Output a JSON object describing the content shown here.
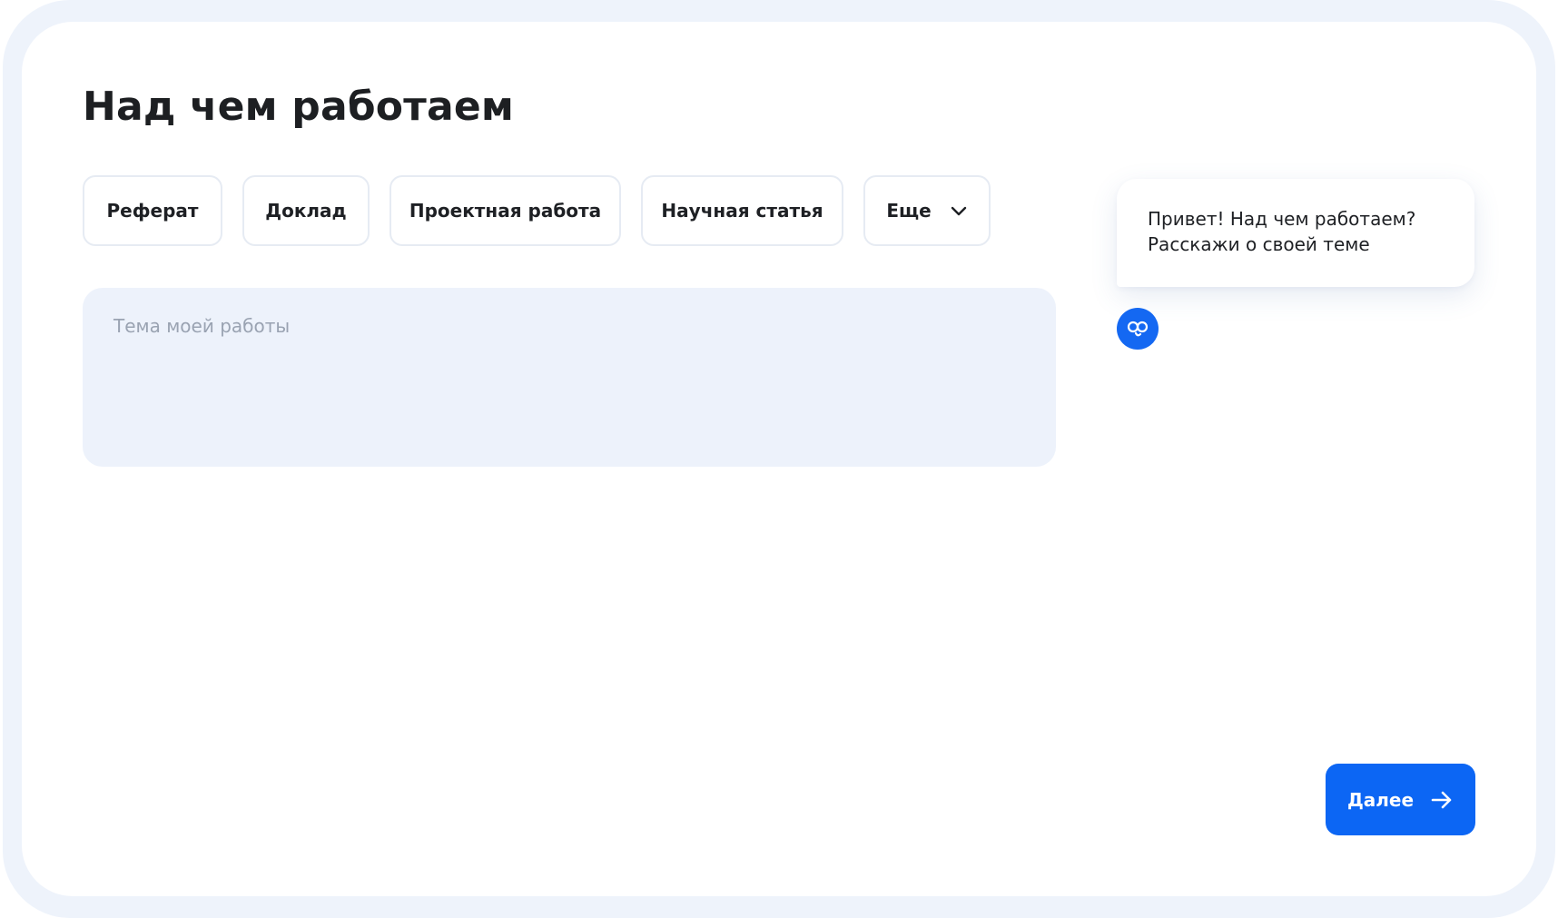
{
  "page": {
    "title": "Над чем работаем"
  },
  "work_types": {
    "chips": [
      {
        "label": "Реферат"
      },
      {
        "label": "Доклад"
      },
      {
        "label": "Проектная работа"
      },
      {
        "label": "Научная статья"
      }
    ],
    "more_label": "Еще",
    "more_icon": "chevron-down-icon"
  },
  "topic": {
    "value": "",
    "placeholder": "Тема моей работы"
  },
  "assistant": {
    "message_lines": [
      "Привет! Над чем работаем?",
      "Расскажи о своей теме"
    ],
    "avatar_icon": "assistant-logo-icon",
    "avatar_color": "#1468f2"
  },
  "actions": {
    "next_label": "Далее",
    "next_icon": "arrow-right-icon",
    "next_color": "#0c66f4"
  }
}
